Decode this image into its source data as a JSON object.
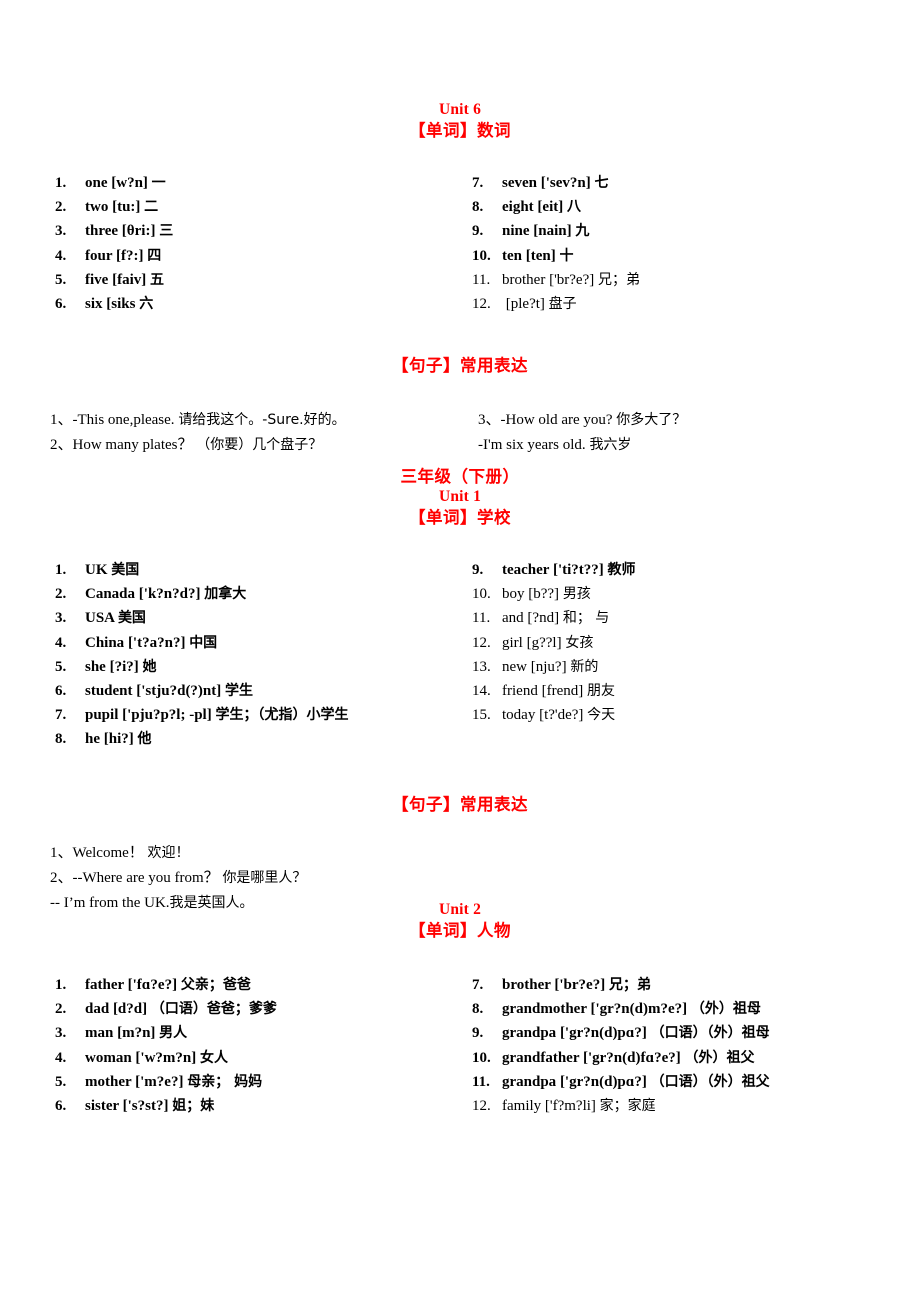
{
  "document": {
    "page_background": "#ffffff",
    "heading_color": "#ff0000",
    "text_color": "#000000"
  },
  "sections": [
    {
      "id": "unit6",
      "headings": [
        {
          "text": "Unit 6",
          "style": "en"
        },
        {
          "text": "【单词】数词",
          "style": "cn"
        }
      ],
      "words_left": [
        {
          "num": "1.",
          "en": "one",
          "ipa": "[w?n]",
          "cn": "一",
          "bold": true
        },
        {
          "num": "2.",
          "en": "two",
          "ipa": "[tu:]",
          "cn": "二",
          "bold": true
        },
        {
          "num": "3.",
          "en": "three",
          "ipa": "[θri:]",
          "cn": "三",
          "bold": true
        },
        {
          "num": "4.",
          "en": "four",
          "ipa": "[f?:]",
          "cn": "四",
          "bold": true
        },
        {
          "num": "5.",
          "en": "five",
          "ipa": "[faiv]",
          "cn": "五",
          "bold": true
        },
        {
          "num": "6.",
          "en": "six",
          "ipa": "[siks",
          "cn": "六",
          "bold": true
        }
      ],
      "words_right": [
        {
          "num": "7.",
          "en": "seven",
          "ipa": "['sev?n]",
          "cn": "七",
          "bold": true
        },
        {
          "num": "8.",
          "en": "eight",
          "ipa": "[eit]",
          "cn": "八",
          "bold": true
        },
        {
          "num": "9.",
          "en": "nine",
          "ipa": "[nain]",
          "cn": "九",
          "bold": true
        },
        {
          "num": "10.",
          "en": "ten",
          "ipa": "[ten]",
          "cn": "十",
          "bold": true
        },
        {
          "num": "11.",
          "en": "brother",
          "ipa": "['br?e?]",
          "cn": "兄；弟",
          "bold": false
        },
        {
          "num": "12.",
          "en": "",
          "ipa": "[ple?t]",
          "cn": "盘子",
          "bold": false
        }
      ],
      "sentence_heading": "【句子】常用表达",
      "sentences_left": [
        {
          "text": "1、-This one,please.",
          "cn": "请给我这个。-Sure.好的。"
        },
        {
          "text": "2、How many plates？",
          "cn": "（你要）几个盘子？"
        }
      ],
      "sentences_right": [
        {
          "text": "3、-How old are you?",
          "cn": "你多大了？"
        },
        {
          "text": "-I'm six years old.",
          "cn": "我六岁"
        }
      ]
    },
    {
      "id": "unit1",
      "headings": [
        {
          "text": "三年级（下册）",
          "style": "grade"
        },
        {
          "text": "Unit 1",
          "style": "en"
        },
        {
          "text": "【单词】学校",
          "style": "cn"
        }
      ],
      "words_left": [
        {
          "num": "1.",
          "en": "UK",
          "ipa": "",
          "cn": "美国",
          "bold": true
        },
        {
          "num": "2.",
          "en": "Canada",
          "ipa": "['k?n?d?]",
          "cn": "加拿大",
          "bold": true
        },
        {
          "num": "3.",
          "en": "USA",
          "ipa": "",
          "cn": "美国",
          "bold": true
        },
        {
          "num": "4.",
          "en": "China",
          "ipa": "['t?a?n?]",
          "cn": "中国",
          "bold": true
        },
        {
          "num": "5.",
          "en": "she",
          "ipa": "[?i?]",
          "cn": "她",
          "bold": true
        },
        {
          "num": "6.",
          "en": "student",
          "ipa": "['stju?d(?)nt]",
          "cn": "学生",
          "bold": true
        },
        {
          "num": "7.",
          "en": "pupil",
          "ipa": "['pju?p?l; -pl]",
          "cn": "学生；（尤指）小学生",
          "bold": true
        },
        {
          "num": "8.",
          "en": "he",
          "ipa": "[hi?]",
          "cn": "他",
          "bold": true
        }
      ],
      "words_right": [
        {
          "num": "9.",
          "en": "teacher",
          "ipa": "['ti?t??]",
          "cn": "教师",
          "bold": true
        },
        {
          "num": "10.",
          "en": "boy",
          "ipa": "[b??]",
          "cn": "男孩",
          "bold": false
        },
        {
          "num": "11.",
          "en": "and",
          "ipa": "[?nd]",
          "cn": "和；  与",
          "bold": false
        },
        {
          "num": "12.",
          "en": "girl",
          "ipa": "[g??l]",
          "cn": "女孩",
          "bold": false
        },
        {
          "num": "13.",
          "en": "new",
          "ipa": "[nju?]",
          "cn": "新的",
          "bold": false
        },
        {
          "num": "14.",
          "en": "friend",
          "ipa": "[frend]",
          "cn": "朋友",
          "bold": false
        },
        {
          "num": "15.",
          "en": "today",
          "ipa": "[t?'de?]",
          "cn": "今天",
          "bold": false
        }
      ],
      "sentence_heading": "【句子】常用表达",
      "sentences_left": [
        {
          "text": "1、Welcome！",
          "cn": "欢迎！"
        },
        {
          "text": "2、--Where are you from？",
          "cn": "你是哪里人？"
        },
        {
          "text": "-- I’m from the UK.",
          "cn": "我是英国人。"
        }
      ],
      "sentences_right": []
    },
    {
      "id": "unit2",
      "headings": [
        {
          "text": "Unit 2",
          "style": "en"
        },
        {
          "text": "【单词】人物",
          "style": "cn"
        }
      ],
      "words_left": [
        {
          "num": "1.",
          "en": "father",
          "ipa": "['fɑ?e?]",
          "cn": "父亲；爸爸",
          "bold": true
        },
        {
          "num": "2.",
          "en": "dad",
          "ipa": "[d?d]",
          "cn": "（口语）爸爸；爹爹",
          "bold": true
        },
        {
          "num": "3.",
          "en": "man",
          "ipa": "[m?n]",
          "cn": "男人",
          "bold": true
        },
        {
          "num": "4.",
          "en": "woman",
          "ipa": "['w?m?n]",
          "cn": "女人",
          "bold": true
        },
        {
          "num": "5.",
          "en": "mother",
          "ipa": "['m?e?]",
          "cn": "母亲；  妈妈",
          "bold": true
        },
        {
          "num": "6.",
          "en": "sister",
          "ipa": "['s?st?]",
          "cn": "姐；妹",
          "bold": true
        }
      ],
      "words_right": [
        {
          "num": "7.",
          "en": "brother",
          "ipa": "['br?e?]",
          "cn": "兄；弟",
          "bold": true
        },
        {
          "num": "8.",
          "en": "grandmother",
          "ipa": "['gr?n(d)m?e?]",
          "cn": "（外）祖母",
          "bold": true
        },
        {
          "num": "9.",
          "en": "grandpa",
          "ipa": "['gr?n(d)pɑ?]",
          "cn": "（口语）（外）祖母",
          "bold": true
        },
        {
          "num": "10.",
          "en": "grandfather",
          "ipa": "['gr?n(d)fɑ?e?]",
          "cn": "（外）祖父",
          "bold": true
        },
        {
          "num": "11.",
          "en": "grandpa",
          "ipa": "['gr?n(d)pɑ?]",
          "cn": "（口语）（外）祖父",
          "bold": true
        },
        {
          "num": "12.",
          "en": "family",
          "ipa": "['f?m?li]",
          "cn": "家；家庭",
          "bold": false
        }
      ],
      "sentence_heading": "",
      "sentences_left": [],
      "sentences_right": []
    }
  ]
}
